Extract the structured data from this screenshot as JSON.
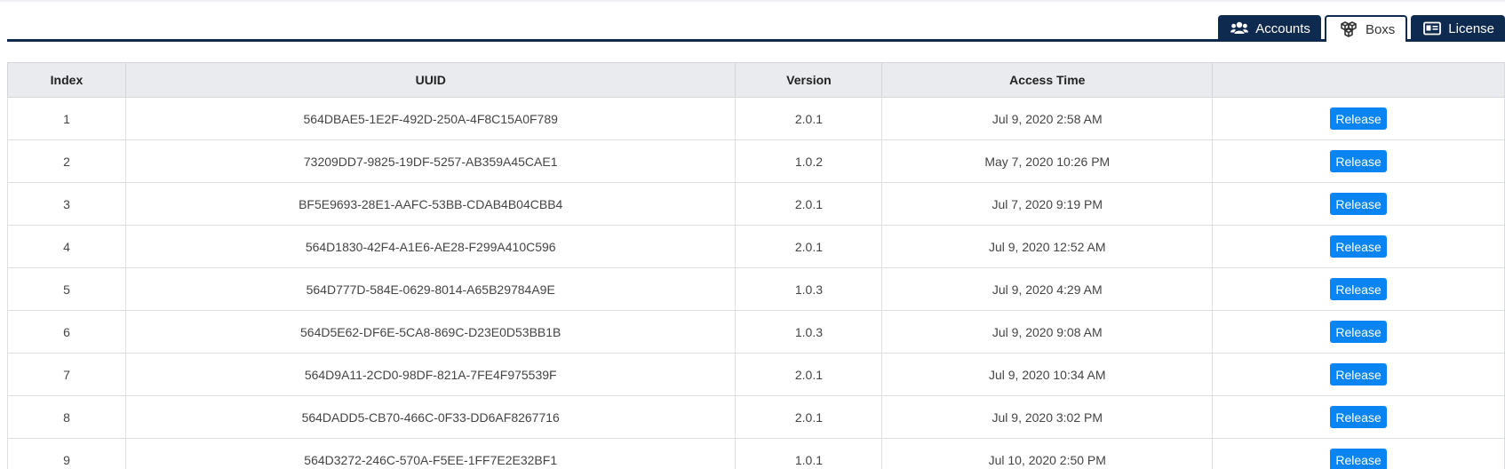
{
  "tabs": [
    {
      "label": "Accounts",
      "icon": "users-icon",
      "active": false
    },
    {
      "label": "Boxs",
      "icon": "cubes-icon",
      "active": true
    },
    {
      "label": "License",
      "icon": "id-card-icon",
      "active": false
    }
  ],
  "table": {
    "headers": [
      "Index",
      "UUID",
      "Version",
      "Access Time",
      ""
    ],
    "action_label": "Release",
    "rows": [
      {
        "index": "1",
        "uuid": "564DBAE5-1E2F-492D-250A-4F8C15A0F789",
        "version": "2.0.1",
        "access_time": "Jul 9, 2020 2:58 AM"
      },
      {
        "index": "2",
        "uuid": "73209DD7-9825-19DF-5257-AB359A45CAE1",
        "version": "1.0.2",
        "access_time": "May 7, 2020 10:26 PM"
      },
      {
        "index": "3",
        "uuid": "BF5E9693-28E1-AAFC-53BB-CDAB4B04CBB4",
        "version": "2.0.1",
        "access_time": "Jul 7, 2020 9:19 PM"
      },
      {
        "index": "4",
        "uuid": "564D1830-42F4-A1E6-AE28-F299A410C596",
        "version": "2.0.1",
        "access_time": "Jul 9, 2020 12:52 AM"
      },
      {
        "index": "5",
        "uuid": "564D777D-584E-0629-8014-A65B29784A9E",
        "version": "1.0.3",
        "access_time": "Jul 9, 2020 4:29 AM"
      },
      {
        "index": "6",
        "uuid": "564D5E62-DF6E-5CA8-869C-D23E0D53BB1B",
        "version": "1.0.3",
        "access_time": "Jul 9, 2020 9:08 AM"
      },
      {
        "index": "7",
        "uuid": "564D9A11-2CD0-98DF-821A-7FE4F975539F",
        "version": "2.0.1",
        "access_time": "Jul 9, 2020 10:34 AM"
      },
      {
        "index": "8",
        "uuid": "564DADD5-CB70-466C-0F33-DD6AF8267716",
        "version": "2.0.1",
        "access_time": "Jul 9, 2020 3:02 PM"
      },
      {
        "index": "9",
        "uuid": "564D3272-246C-570A-F5EE-1FF7E2E32BF1",
        "version": "1.0.1",
        "access_time": "Jul 10, 2020 2:50 PM"
      }
    ]
  },
  "colors": {
    "navy": "#0f2a4f",
    "button_blue": "#0a84f0",
    "header_bg": "#e9ebee"
  }
}
